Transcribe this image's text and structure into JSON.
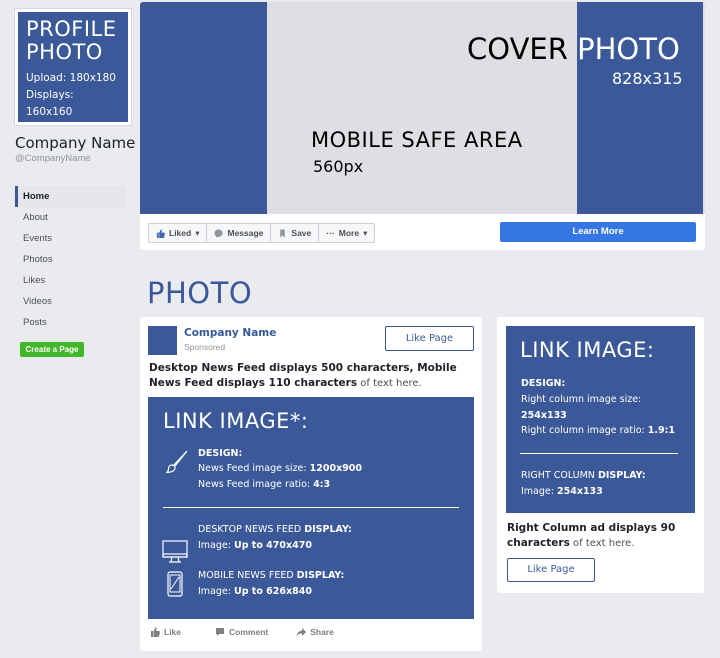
{
  "profile": {
    "title_line1": "PROFILE",
    "title_line2": "PHOTO",
    "upload": "Upload: 180x180",
    "displays": "Displays: 160x160",
    "company_name": "Company Name",
    "handle": "@CompanyName"
  },
  "nav": {
    "items": [
      "Home",
      "About",
      "Events",
      "Photos",
      "Likes",
      "Videos",
      "Posts"
    ],
    "active": "Home",
    "create_page": "Create a Page"
  },
  "cover": {
    "title_part1": "COVER ",
    "title_part2": "PHOTO",
    "size": "828x315",
    "mobile_title": "MOBILE SAFE AREA",
    "mobile_size": "560px",
    "colors": {
      "brand": "#3b5998",
      "safe_area": "#dddfe2",
      "cta": "#3578e5",
      "create": "#42b72a"
    }
  },
  "actions": {
    "liked": "Liked",
    "message": "Message",
    "save": "Save",
    "more": "More",
    "learn_more": "Learn More"
  },
  "section": {
    "photo_heading": "PHOTO"
  },
  "post": {
    "company": "Company Name",
    "sponsored": "Sponsored",
    "like_page": "Like Page",
    "text_bold": "Desktop News Feed displays 500 characters, Mobile News Feed displays 110 characters",
    "text_rest": " of text here.",
    "link_title": "LINK IMAGE*:",
    "design_label": "DESIGN:",
    "size_label": "News Feed image size: ",
    "size_value": "1200x900",
    "ratio_label": "News Feed image ratio: ",
    "ratio_value": "4:3",
    "desktop_label_a": "DESKTOP NEWS FEED ",
    "desktop_label_b": "DISPLAY:",
    "desktop_image_label": "Image: ",
    "desktop_image_value": "Up to 470x470",
    "mobile_label_a": "MOBILE NEWS FEED ",
    "mobile_label_b": "DISPLAY:",
    "mobile_image_label": "Image: ",
    "mobile_image_value": "Up to 626x840",
    "like": "Like",
    "comment": "Comment",
    "share": "Share"
  },
  "right": {
    "link_title": "LINK IMAGE:",
    "design_label": "DESIGN:",
    "size_label": "Right column image size:",
    "size_value": "254x133",
    "ratio_label": "Right column image ratio: ",
    "ratio_value": "1.9:1",
    "display_label_a": "RIGHT COLUMN ",
    "display_label_b": "DISPLAY:",
    "image_label": "Image: ",
    "image_value": "254x133",
    "text_bold": "Right Column ad displays 90 characters",
    "text_rest": " of text here.",
    "like_page": "Like Page"
  }
}
